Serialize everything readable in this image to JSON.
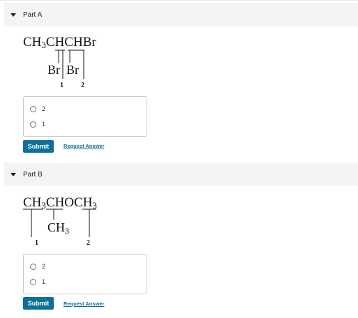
{
  "parts": [
    {
      "title": "Part A",
      "formula_main": [
        "CH",
        "3",
        "CHCHBr"
      ],
      "formula_sub": [
        "Br",
        "Br"
      ],
      "numbers": [
        "1",
        "2"
      ],
      "choices": [
        "2",
        "1"
      ],
      "submit_label": "Submit",
      "request_label": "Request Answer"
    },
    {
      "title": "Part B",
      "formula_main": [
        "CH",
        "3",
        "CHOCH",
        "3"
      ],
      "formula_sub": [
        "CH",
        "3"
      ],
      "numbers": [
        "1",
        "2"
      ],
      "choices": [
        "2",
        "1"
      ],
      "submit_label": "Submit",
      "request_label": "Request Answer"
    }
  ]
}
